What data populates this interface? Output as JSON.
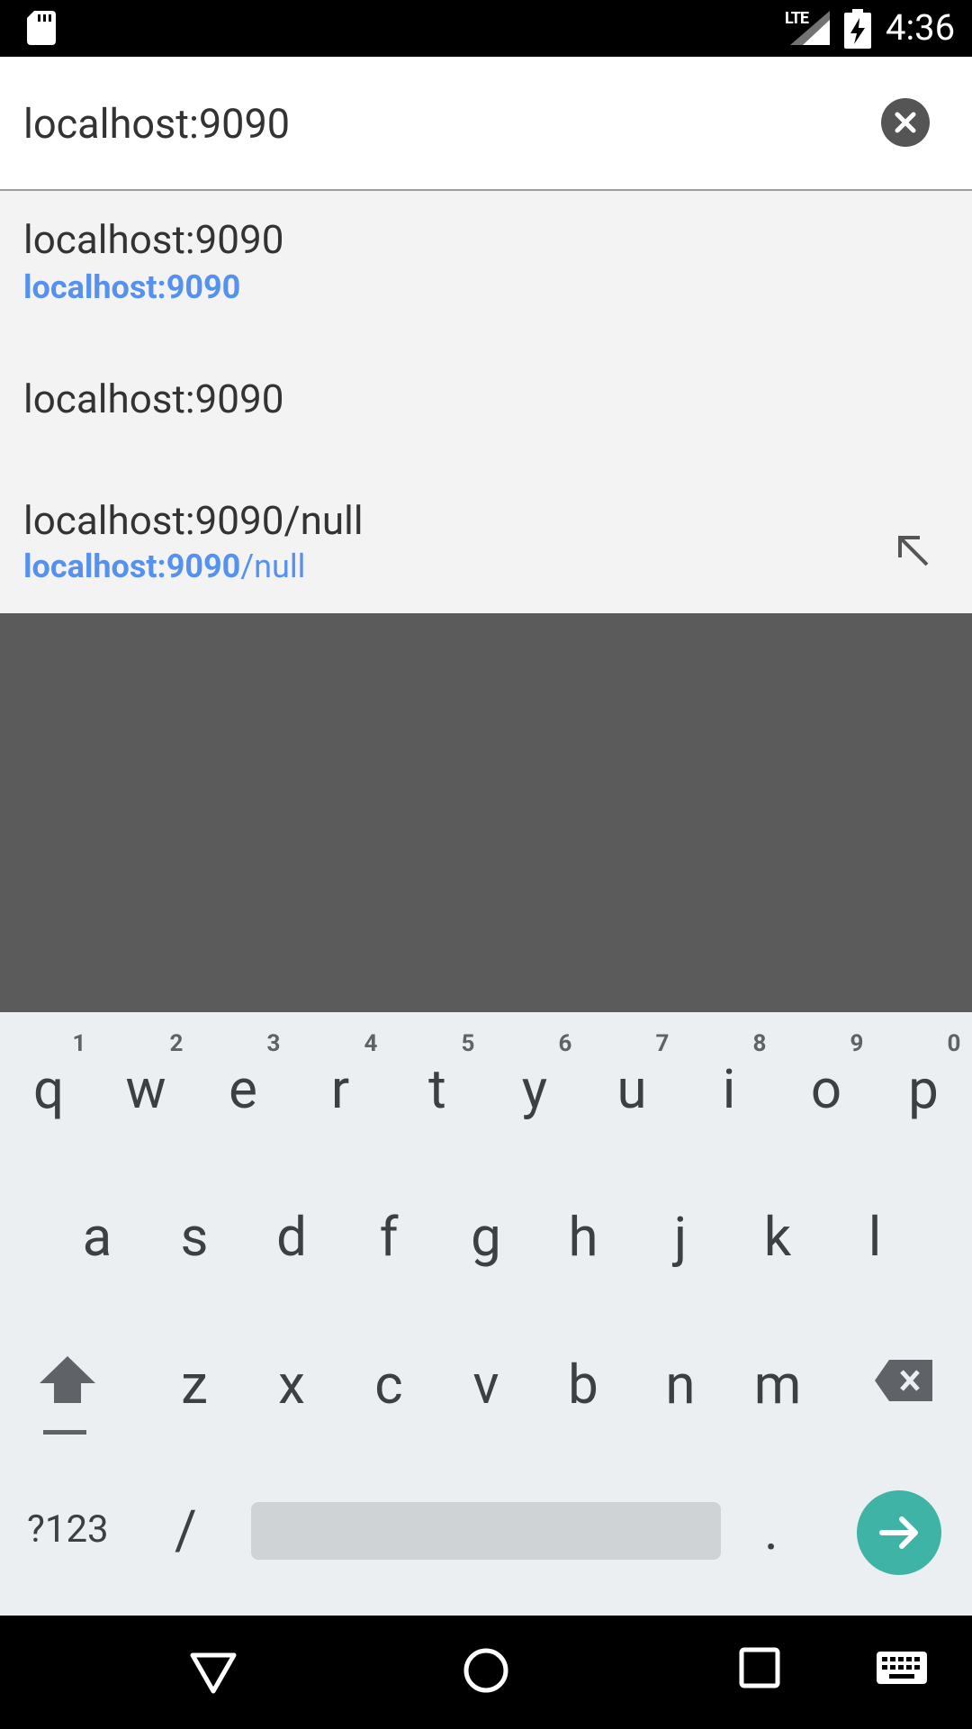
{
  "status_bar": {
    "network": "LTE",
    "time": "4:36"
  },
  "address_bar": {
    "value": "localhost:9090"
  },
  "suggestions": [
    {
      "title": "localhost:9090",
      "url_bold": "localhost:9090",
      "url_rest": ""
    },
    {
      "title": "localhost:9090"
    },
    {
      "title": "localhost:9090/null",
      "url_bold": "localhost:9090",
      "url_rest": "/null"
    }
  ],
  "keyboard": {
    "row1": [
      {
        "key": "q",
        "hint": "1"
      },
      {
        "key": "w",
        "hint": "2"
      },
      {
        "key": "e",
        "hint": "3"
      },
      {
        "key": "r",
        "hint": "4"
      },
      {
        "key": "t",
        "hint": "5"
      },
      {
        "key": "y",
        "hint": "6"
      },
      {
        "key": "u",
        "hint": "7"
      },
      {
        "key": "i",
        "hint": "8"
      },
      {
        "key": "o",
        "hint": "9"
      },
      {
        "key": "p",
        "hint": "0"
      }
    ],
    "row2": [
      "a",
      "s",
      "d",
      "f",
      "g",
      "h",
      "j",
      "k",
      "l"
    ],
    "row3": [
      "z",
      "x",
      "c",
      "v",
      "b",
      "n",
      "m"
    ],
    "symbols_label": "?123",
    "slash_label": "/",
    "period_label": ".",
    "go_color": "#3fb3a6"
  },
  "colors": {
    "url_accent": "#5591ee",
    "keyboard_bg": "#eceff1",
    "scrim": "#5b5b5b"
  }
}
